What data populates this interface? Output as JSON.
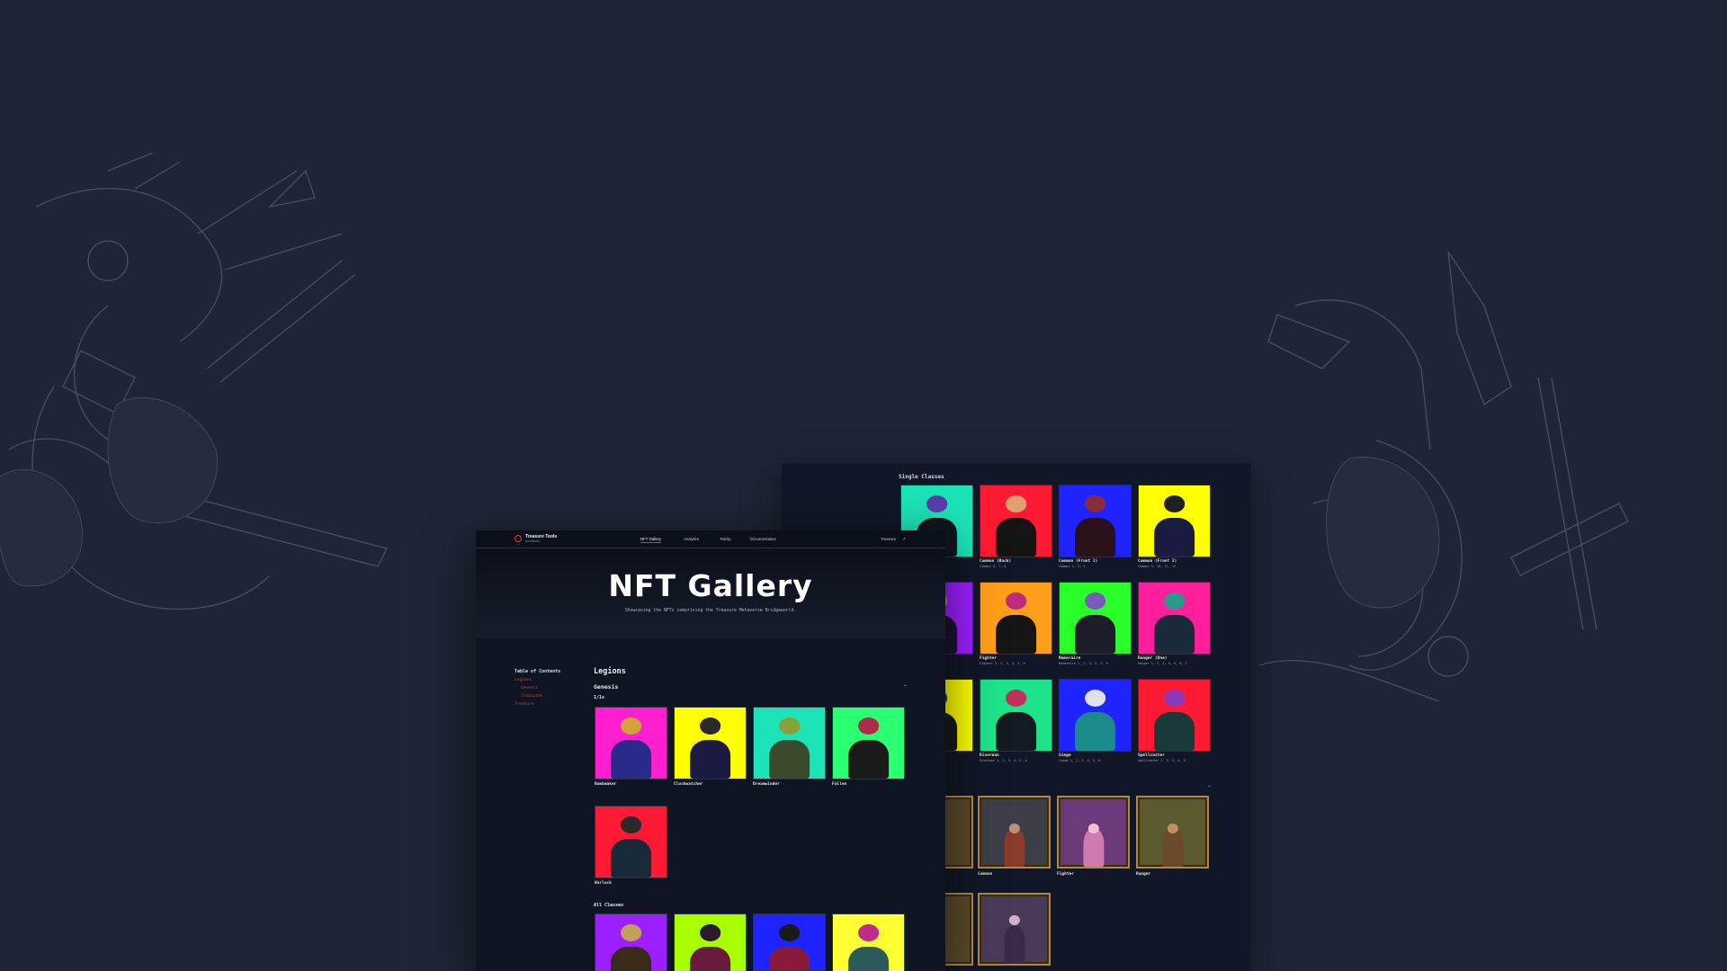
{
  "front": {
    "nav": {
      "brand": "Treasure Tools",
      "brand_sub": "(unofficial)",
      "items": [
        "NFT Gallery",
        "Analytics",
        "Rarity",
        "Documentation"
      ],
      "external": "Treasure"
    },
    "hero": {
      "title": "NFT Gallery",
      "subtitle": "Showcasing the NFTs comprising the Treasure Metaverse Bridgeworld."
    },
    "toc": {
      "title": "Table of Contents",
      "links": [
        "Legions",
        "Genesis",
        "Treasures",
        "Treasure"
      ]
    },
    "section": "Legions",
    "subsection": "Genesis",
    "group_1of1": "1/1s",
    "group_all": "All Classes",
    "cards": [
      {
        "name": "Bombmaker",
        "bg": "#ff1fd0"
      },
      {
        "name": "Clockwatcher",
        "bg": "#ffff00"
      },
      {
        "name": "Dreamwinder",
        "bg": "#1de3b8"
      },
      {
        "name": "Fallen",
        "bg": "#2bff72"
      },
      {
        "name": "Warlock",
        "bg": "#ff1a33"
      }
    ],
    "all_classes_colors": [
      "#9b1fff",
      "#a8ff00",
      "#1f24ff",
      "#ffff33"
    ]
  },
  "back": {
    "section": "Single Classes",
    "cards": [
      {
        "name": "",
        "bg": "#1de3b8",
        "sub": ""
      },
      {
        "name": "Common (Back)",
        "bg": "#ff1a33",
        "sub": "Common 4, 7, 8"
      },
      {
        "name": "Common (Front 1)",
        "bg": "#1f24ff",
        "sub": "Common 1, 4, 3"
      },
      {
        "name": "Common (Front 2)",
        "bg": "#ffff00",
        "sub": "Common 5, 10, 11, 12"
      },
      {
        "name": "Fighter",
        "bg": "#ff9e1b",
        "sub": "Fighter 1, 2, 3, 4, 5, 6"
      },
      {
        "name": "Numeraire",
        "bg": "#2bff2b",
        "sub": "Numeraire 1, 2, 3, 4, 5, 6"
      },
      {
        "name": "Ranger (One)",
        "bg": "#ff1f9d",
        "sub": "Ranger 1, 2, 3, 4, 5, 6, 7"
      },
      {
        "name": "Riverman",
        "bg": "#1de38a",
        "sub": "Riverman 1, 2, 3, 4, 5, 6"
      },
      {
        "name": "Siege",
        "bg": "#1f24ff",
        "sub": "Siege 1, 2, 3, 4, 5, 6"
      },
      {
        "name": "Spellcaster",
        "bg": "#ff1a33",
        "sub": "Spellcaster 1, 2, 3, 4, 5"
      }
    ],
    "framed": [
      {
        "name": "Common",
        "bg": "#3c3f48"
      },
      {
        "name": "Fighter",
        "bg": "#6b3a7a"
      },
      {
        "name": "Ranger",
        "bg": "#5a5a2e"
      }
    ]
  }
}
